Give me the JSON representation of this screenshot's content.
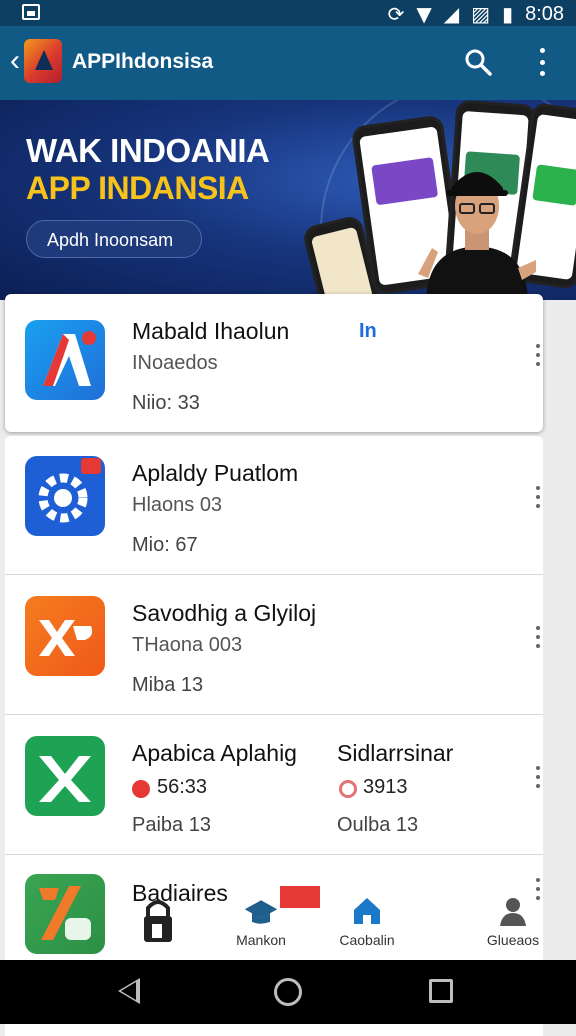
{
  "status_bar": {
    "time": "8:08"
  },
  "app_bar": {
    "title": "APPIhdonsisa",
    "back_icon": "back-arrow-icon",
    "search_icon": "search-icon",
    "more_icon": "more-vert-icon"
  },
  "banner": {
    "title_line1": "WAK INDOANIA",
    "title_line2": "APP INDANSIA",
    "button_label": "Apdh Inoonsam"
  },
  "apps": [
    {
      "title": "Mabald Ihaolun",
      "subtitle": "INoaedos",
      "meta": "Niio: 33",
      "badge": "In",
      "icon": "app-a-icon",
      "color": "#2196f3"
    },
    {
      "title": "Aplaldy Puatlom",
      "subtitle": "Hlaons 03",
      "meta": "Mio: 67",
      "icon": "gear-app-icon",
      "color": "#1e5fd6"
    },
    {
      "title": "Savodhig a Glyiloj",
      "subtitle": "THaona 003",
      "meta": "Miba 13",
      "icon": "xp-app-icon",
      "color": "#f26b1d"
    },
    {
      "title": "Apabica Aplahig",
      "subtitle": "56:33",
      "meta": "Paiba 13",
      "icon": "x-app-icon",
      "color": "#1ea354",
      "second_title": "Sidlarrsinar",
      "second_subtitle": "3913",
      "second_meta": "Oulba 13"
    },
    {
      "title": "Badiaires",
      "icon": "percent-app-icon",
      "color": "#2faa58"
    }
  ],
  "bottom_tabs": [
    {
      "label": "",
      "icon": "lock-user-icon"
    },
    {
      "label": "Mankon",
      "icon": "graduation-cap-icon"
    },
    {
      "label": "Caobalin",
      "icon": "home-icon"
    },
    {
      "label": "Glueaos",
      "icon": "person-icon"
    }
  ],
  "nav_bar": {
    "back": "triangle-back-icon",
    "home": "circle-home-icon",
    "recents": "square-recents-icon"
  }
}
